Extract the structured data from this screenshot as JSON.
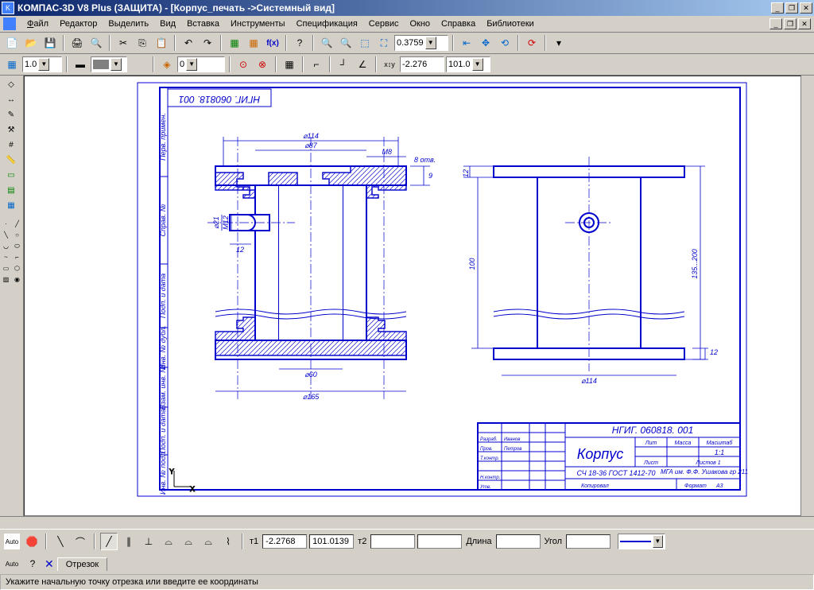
{
  "window": {
    "title": "КОМПАС-3D V8 Plus (ЗАЩИТА) - [Корпус_печать ->Системный вид]"
  },
  "menu": {
    "file": "Файл",
    "edit": "Редактор",
    "select": "Выделить",
    "view": "Вид",
    "insert": "Вставка",
    "tools": "Инструменты",
    "spec": "Спецификация",
    "service": "Сервис",
    "window": "Окно",
    "help": "Справка",
    "libs": "Библиотеки"
  },
  "toolbar1": {
    "zoom_value": "0.3759"
  },
  "toolbar2": {
    "lineweight": "1.0",
    "layer": "0",
    "coord_x": "-2.276",
    "coord_y": "101.0"
  },
  "drawing": {
    "doc_number_rot": "НГИГ. 060818. 001",
    "dims": {
      "d114": "⌀114",
      "d87": "⌀87",
      "m8": "М8",
      "holes8": "8 отв.",
      "h9": "9",
      "d21": "⌀21",
      "m12": "М12",
      "h12": "12",
      "d60": "⌀60",
      "d165": "⌀165",
      "v12a": "12",
      "v100": "100",
      "v135": "135...200",
      "v12b": "12",
      "d114b": "⌀114"
    },
    "titleblock": {
      "number": "НГИГ. 060818. 001",
      "name": "Корпус",
      "material": "СЧ 18-36 ГОСТ 1412-70",
      "org": "МГА им. Ф.Ф. Ушакова гр 211",
      "scale_col": "Масштаб",
      "mass_col": "Масса",
      "lit_col": "Лит",
      "scale": "1:1",
      "sheet": "Лист",
      "sheets": "Листов 1",
      "format": "Формат",
      "format_v": "А3",
      "check": "Копировал",
      "roles": {
        "r1": "Разраб.",
        "r2": "Пров.",
        "r3": "Т.контр.",
        "r4": "Н.контр.",
        "r5": "Утв."
      },
      "names": {
        "n1": "Иванов",
        "n2": "Петров"
      }
    },
    "side_labels": {
      "s1": "Перв. примен.",
      "s2": "Справ. №",
      "s3": "Подп. и дата",
      "s4": "Инв. № дубл.",
      "s5": "Взам. инв. №",
      "s6": "Подп. и дата",
      "s7": "Инв. № подл."
    }
  },
  "prop_bar": {
    "t1": "т1",
    "t1x": "-2.2768",
    "t1y": "101.0139",
    "t2": "т2",
    "t2x": "",
    "t2y": "",
    "len_label": "Длина",
    "len": "",
    "ang_label": "Угол",
    "ang": ""
  },
  "tab": {
    "name": "Отрезок"
  },
  "status": {
    "text": "Укажите начальную точку отрезка или введите ее координаты"
  }
}
